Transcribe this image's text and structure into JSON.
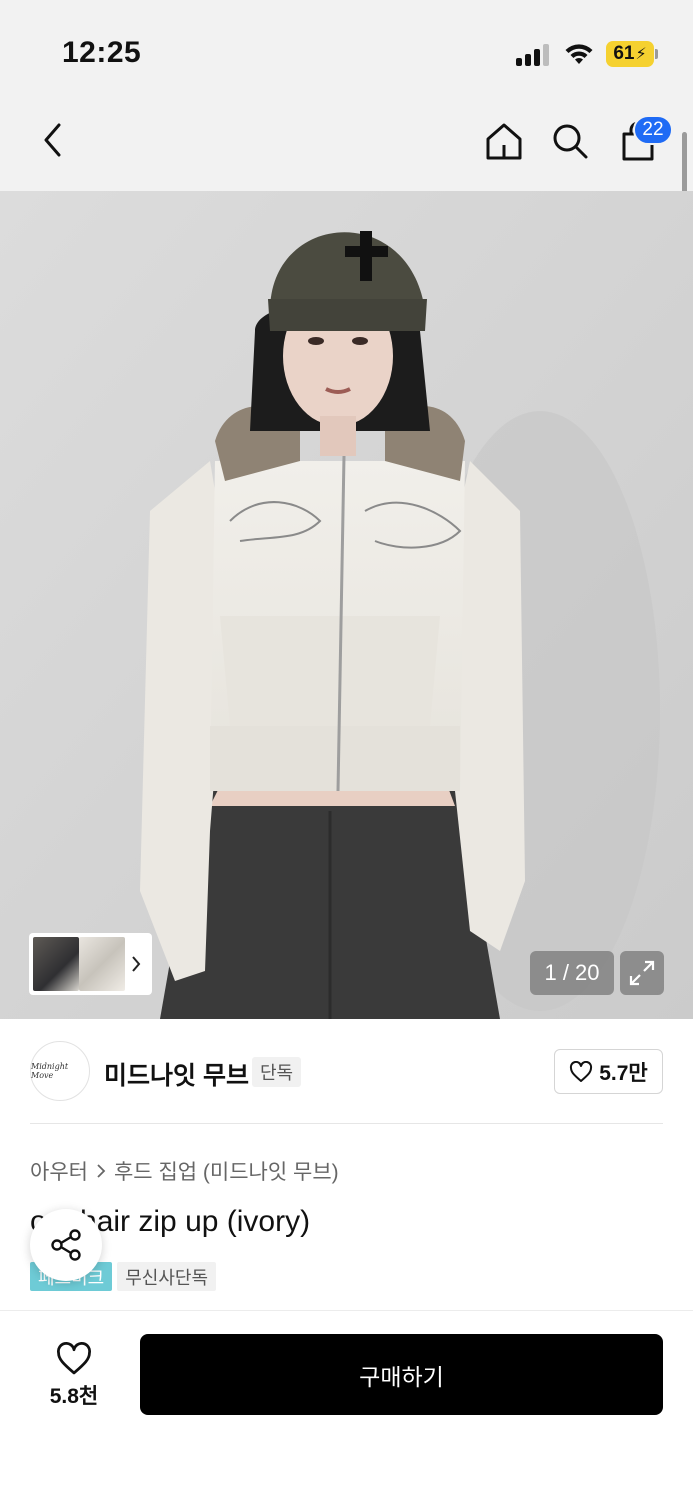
{
  "status_bar": {
    "time": "12:25",
    "battery": "61"
  },
  "header": {
    "icons": [
      "back-arrow-icon",
      "home-icon",
      "search-icon",
      "shopping-bag-icon"
    ],
    "cart_count": "22"
  },
  "gallery": {
    "counter": "1 / 20",
    "icons": [
      "chevron-right-icon",
      "expand-icon"
    ]
  },
  "brand": {
    "logo_text": "Midnight Move",
    "name": "미드나잇 무브",
    "exclusive_tag": "단독",
    "likes": "5.7만"
  },
  "product": {
    "breadcrumb": [
      "아우터",
      "후드 집업 (미드나잇 무브)"
    ],
    "title": "o... hair zip up (ivory)",
    "tags": [
      "페르미크",
      "무신사단독"
    ]
  },
  "bottom_bar": {
    "like_count": "5.8천",
    "buy_label": "구매하기"
  },
  "colors": {
    "cart_badge": "#1f6bf5",
    "battery": "#f5d130",
    "buy_button": "#000000",
    "sale_tag": "#6ecbd6"
  }
}
